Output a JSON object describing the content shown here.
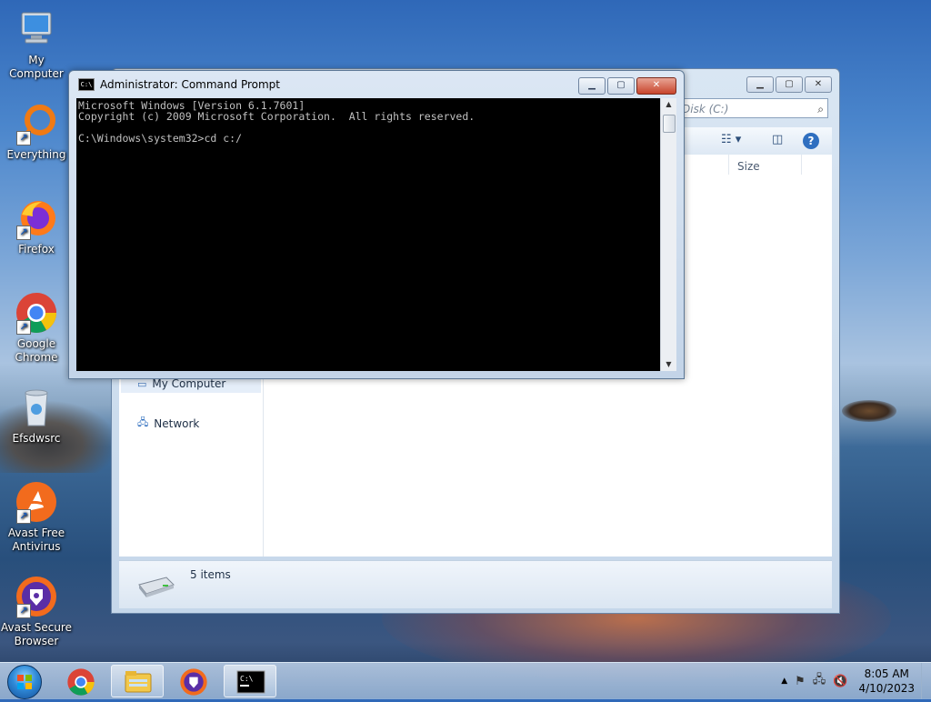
{
  "desktop_icons": [
    {
      "label": "My Computer",
      "icon": "computer-icon"
    },
    {
      "label": "Everything",
      "icon": "everything-search-icon"
    },
    {
      "label": "Firefox",
      "icon": "firefox-icon"
    },
    {
      "label": "Google\nChrome",
      "icon": "chrome-icon"
    },
    {
      "label": "Efsdwsrc",
      "icon": "recycle-bin-icon"
    },
    {
      "label": "Avast Free\nAntivirus",
      "icon": "avast-antivirus-icon"
    },
    {
      "label": "Avast Secure\nBrowser",
      "icon": "avast-browser-icon"
    }
  ],
  "cmd": {
    "title": "Administrator: Command Prompt",
    "lines": "Microsoft Windows [Version 6.1.7601]\nCopyright (c) 2009 Microsoft Corporation.  All rights reserved.\n\nC:\\Windows\\system32>cd c:/"
  },
  "explorer": {
    "search_placeholder": "Disk (C:)",
    "column_size": "Size",
    "nav": {
      "my_computer": "My Computer",
      "network": "Network"
    },
    "status": "5 items"
  },
  "taskbar": {
    "time": "8:05 AM",
    "date": "4/10/2023",
    "apps": [
      "chrome-icon",
      "file-explorer-icon",
      "avast-browser-icon",
      "command-prompt-icon"
    ]
  }
}
